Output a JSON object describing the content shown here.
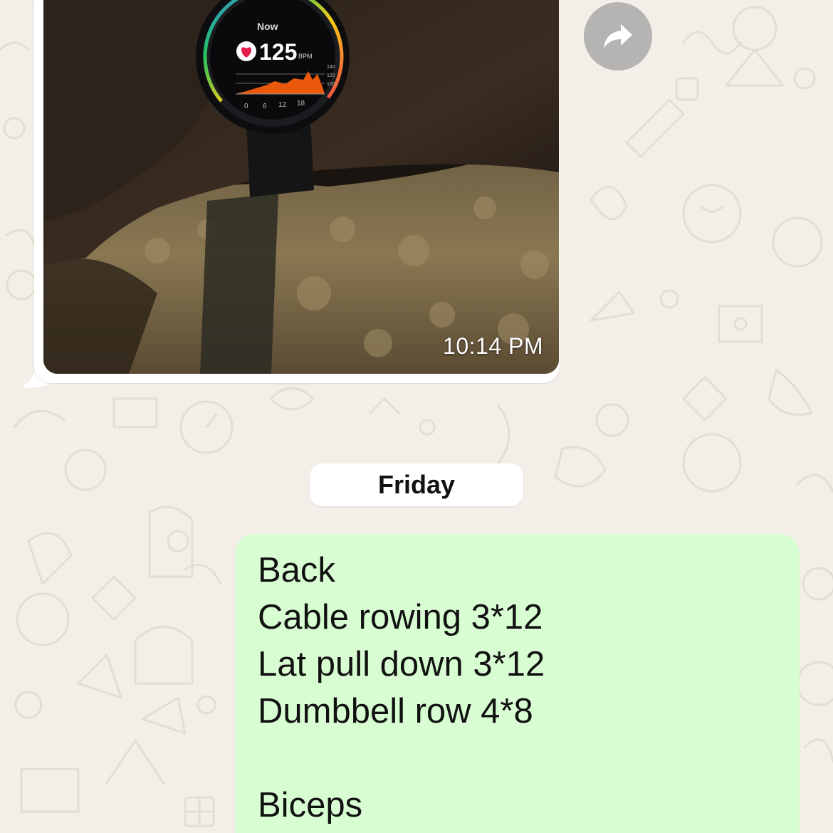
{
  "image_message": {
    "timestamp": "10:14 PM",
    "watch_screen": {
      "label_now": "Now",
      "heart_rate": "125",
      "unit": "BPM",
      "graph_axis": [
        "0",
        "6",
        "12",
        "18"
      ],
      "graph_scale": [
        "140",
        "120",
        "100"
      ]
    }
  },
  "forward_button": {
    "icon": "forward-arrow-icon"
  },
  "date_divider": {
    "label": "Friday"
  },
  "outgoing_message": {
    "lines": [
      "Back",
      "Cable rowing 3*12",
      "Lat pull down 3*12",
      "Dumbbell row 4*8",
      "",
      "Biceps"
    ]
  },
  "colors": {
    "wallpaper": "#f3efe8",
    "outgoing_bubble": "#d9fdd3",
    "incoming_bubble": "#ffffff",
    "date_chip": "#ffffff"
  }
}
